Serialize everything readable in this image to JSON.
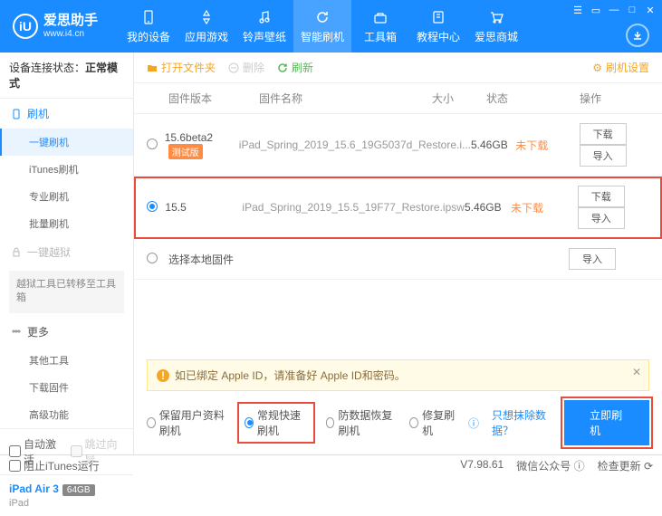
{
  "app": {
    "name": "爱思助手",
    "url": "www.i4.cn"
  },
  "nav": {
    "items": [
      "我的设备",
      "应用游戏",
      "铃声壁纸",
      "智能刷机",
      "工具箱",
      "教程中心",
      "爱思商城"
    ],
    "active": 3
  },
  "status": {
    "label": "设备连接状态：",
    "value": "正常模式"
  },
  "sidebar": {
    "flash": {
      "title": "刷机",
      "items": [
        "一键刷机",
        "iTunes刷机",
        "专业刷机",
        "批量刷机"
      ],
      "active": 0
    },
    "jailbreak": {
      "title": "一键越狱",
      "note": "越狱工具已转移至工具箱"
    },
    "more": {
      "title": "更多",
      "items": [
        "其他工具",
        "下载固件",
        "高级功能"
      ]
    },
    "checks": {
      "auto": "自动激活",
      "skip": "跳过向导"
    }
  },
  "device": {
    "name": "iPad Air 3",
    "storage": "64GB",
    "type": "iPad"
  },
  "toolbar": {
    "open": "打开文件夹",
    "delete": "删除",
    "refresh": "刷新",
    "settings": "刷机设置"
  },
  "table": {
    "headers": {
      "ver": "固件版本",
      "name": "固件名称",
      "size": "大小",
      "status": "状态",
      "ops": "操作"
    },
    "rows": [
      {
        "ver": "15.6beta2",
        "tag": "测试版",
        "name": "iPad_Spring_2019_15.6_19G5037d_Restore.i...",
        "size": "5.46GB",
        "status": "未下载",
        "selected": false,
        "highlight": false
      },
      {
        "ver": "15.5",
        "tag": "",
        "name": "iPad_Spring_2019_15.5_19F77_Restore.ipsw",
        "size": "5.46GB",
        "status": "未下载",
        "selected": true,
        "highlight": true
      }
    ],
    "local": "选择本地固件",
    "btn_dl": "下载",
    "btn_imp": "导入"
  },
  "warning": "如已绑定 Apple ID，请准备好 Apple ID和密码。",
  "options": {
    "o1": "保留用户资料刷机",
    "o2": "常规快速刷机",
    "o3": "防数据恢复刷机",
    "o4": "修复刷机",
    "link": "只想抹除数据？",
    "go": "立即刷机"
  },
  "footer": {
    "block": "阻止iTunes运行",
    "ver": "V7.98.61",
    "wechat": "微信公众号",
    "update": "检查更新"
  }
}
